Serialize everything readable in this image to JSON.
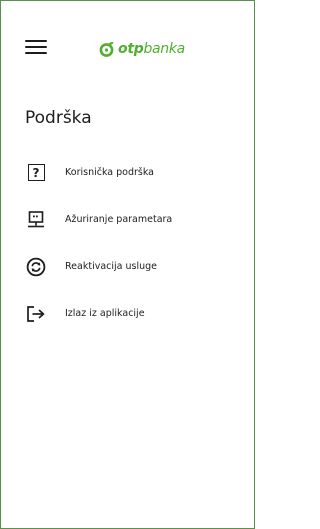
{
  "header": {
    "menu_icon": "hamburger-menu-icon",
    "logo": {
      "mark_icon": "otp-logo-mark",
      "text_bold": "otp",
      "text_regular": "banka",
      "color": "#52ae30"
    }
  },
  "section": {
    "title": "Podrška"
  },
  "menu": {
    "items": [
      {
        "label": "Korisnička podrška",
        "icon": "question-box-icon"
      },
      {
        "label": "Ažuriranje parametara",
        "icon": "terminal-settings-icon"
      },
      {
        "label": "Reaktivacija usluge",
        "icon": "refresh-circle-icon"
      },
      {
        "label": "Izlaz iz aplikacije",
        "icon": "logout-icon"
      }
    ]
  },
  "colors": {
    "frame_border": "#5b8f4e",
    "text": "#1d1d1d",
    "brand_green": "#52ae30"
  }
}
